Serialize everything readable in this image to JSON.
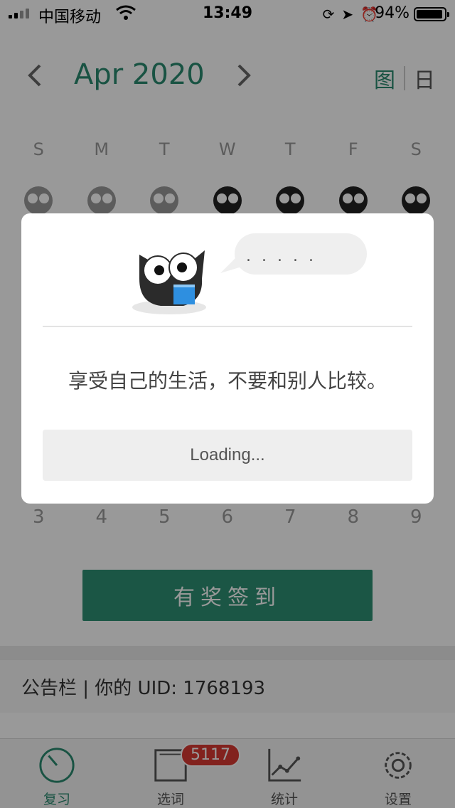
{
  "status_bar": {
    "carrier": "中国移动",
    "time": "13:49",
    "battery": "94%",
    "battery_level": 0.94
  },
  "header": {
    "month_title": "Apr 2020",
    "view_graph_label": "图",
    "view_day_label": "日"
  },
  "calendar": {
    "weekdays": [
      "S",
      "M",
      "T",
      "W",
      "T",
      "F",
      "S"
    ],
    "bottom_dates": [
      "3",
      "4",
      "5",
      "6",
      "7",
      "8",
      "9"
    ]
  },
  "checkin": {
    "label": "有奖签到"
  },
  "notice": {
    "text": "公告栏 | 你的 UID: 1768193"
  },
  "tabs": [
    {
      "label": "复习",
      "icon": "review-timer-icon"
    },
    {
      "label": "选词",
      "icon": "wordbook-icon",
      "badge": "5117"
    },
    {
      "label": "统计",
      "icon": "stats-chart-icon"
    },
    {
      "label": "设置",
      "icon": "gear-icon"
    }
  ],
  "modal": {
    "bubble_text": ". . . . .",
    "quote": "享受自己的生活，不要和别人比较。",
    "loading_label": "Loading..."
  },
  "colors": {
    "accent": "#2a8a70",
    "button": "#2d8f74",
    "badge": "#d93a32"
  }
}
